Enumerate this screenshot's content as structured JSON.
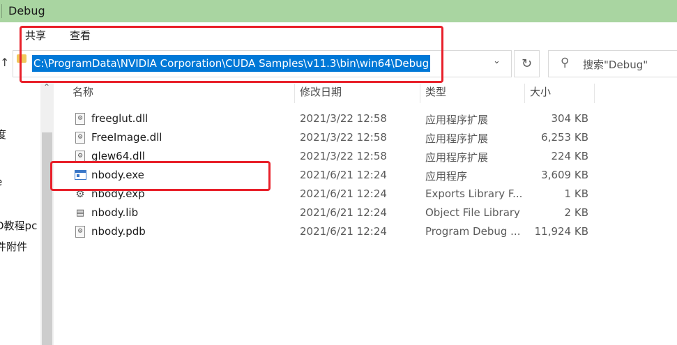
{
  "window": {
    "title": "Debug"
  },
  "ribbon": {
    "tabs": [
      "共享",
      "查看"
    ]
  },
  "address_bar": {
    "path": "C:\\ProgramData\\NVIDIA Corporation\\CUDA Samples\\v11.3\\bin\\win64\\Debug",
    "search_placeholder": "搜索\"Debug\""
  },
  "nav_pane": {
    "items": [
      "度",
      "e",
      "D教程pc",
      "件附件"
    ]
  },
  "columns": {
    "name": "名称",
    "date": "修改日期",
    "type": "类型",
    "size": "大小"
  },
  "files": [
    {
      "name": "freeglut.dll",
      "date": "2021/3/22 12:58",
      "type": "应用程序扩展",
      "size": "304 KB",
      "icon": "dll-file-icon"
    },
    {
      "name": "FreeImage.dll",
      "date": "2021/3/22 12:58",
      "type": "应用程序扩展",
      "size": "6,253 KB",
      "icon": "dll-file-icon"
    },
    {
      "name": "glew64.dll",
      "date": "2021/3/22 12:58",
      "type": "应用程序扩展",
      "size": "224 KB",
      "icon": "dll-file-icon"
    },
    {
      "name": "nbody.exe",
      "date": "2021/6/21 12:24",
      "type": "应用程序",
      "size": "3,609 KB",
      "icon": "exe-file-icon"
    },
    {
      "name": "nbody.exp",
      "date": "2021/6/21 12:24",
      "type": "Exports Library F...",
      "size": "1 KB",
      "icon": "exp-file-icon"
    },
    {
      "name": "nbody.lib",
      "date": "2021/6/21 12:24",
      "type": "Object File Library",
      "size": "2 KB",
      "icon": "lib-file-icon"
    },
    {
      "name": "nbody.pdb",
      "date": "2021/6/21 12:24",
      "type": "Program Debug ...",
      "size": "11,924 KB",
      "icon": "pdb-file-icon"
    }
  ],
  "colors": {
    "titlebar": "#a9d5a1",
    "selection": "#0078d7",
    "annotation": "#e8202a"
  }
}
